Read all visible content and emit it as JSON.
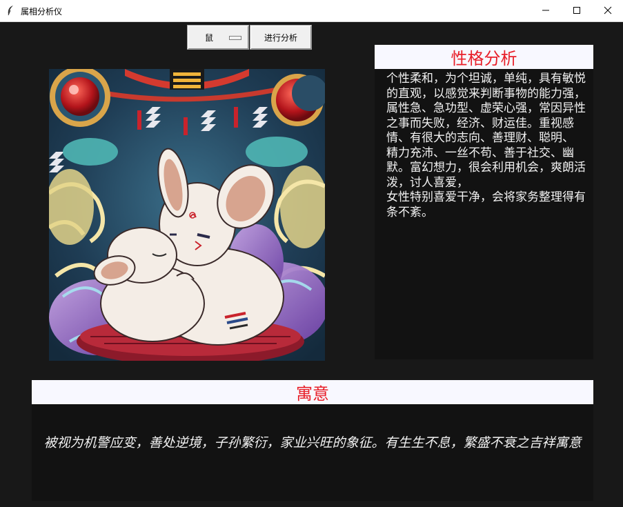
{
  "window": {
    "title": "属相分析仪",
    "controls": [
      "minimize",
      "maximize",
      "close"
    ]
  },
  "toolbar": {
    "zodiac_selected": "鼠",
    "analyze_label": "进行分析"
  },
  "image": {
    "description": "illustration-two-white-rats-hugging"
  },
  "personality": {
    "title": "性格分析",
    "text": "个性柔和，为个坦诚，单纯，具有敏悦的直观，以感觉来判断事物的能力强，属性急、急功型、虚荣心强，常因异性之事而失败，经济、财运佳。重视感情、有很大的志向、善理财、聪明、\n精力充沛、一丝不苟、善于社交、幽默。富幻想力，很会利用机会，爽朗活泼，讨人喜爱，\n女性特别喜爱干净，会将家务整理得有条不紊。"
  },
  "meaning": {
    "title": "寓意",
    "text": "被视为机警应变，善处逆境，子孙繁衍，家业兴旺的象征。有生生不息，繁盛不衰之吉祥寓意"
  },
  "colors": {
    "background": "#181818",
    "header_bg": "#f8f8ff",
    "header_text": "#e8202a",
    "body_text": "#f2f2f2"
  }
}
